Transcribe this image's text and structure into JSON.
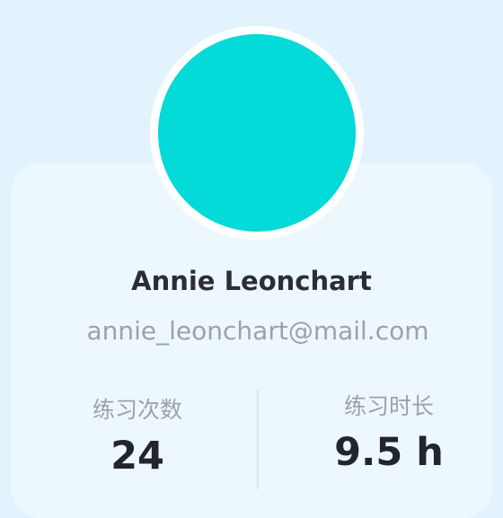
{
  "profile": {
    "name": "Annie Leonchart",
    "email": "annie_leonchart@mail.com",
    "avatar_color": "#04dad8"
  },
  "stats": [
    {
      "label": "练习次数",
      "value": "24"
    },
    {
      "label": "练习时长",
      "value": "9.5 h"
    }
  ],
  "colors": {
    "background": "#e3f3fd",
    "card": "#edf8fe",
    "name_text": "#2c2e34",
    "secondary_text": "#9da2aa",
    "value_text": "#22252b"
  }
}
